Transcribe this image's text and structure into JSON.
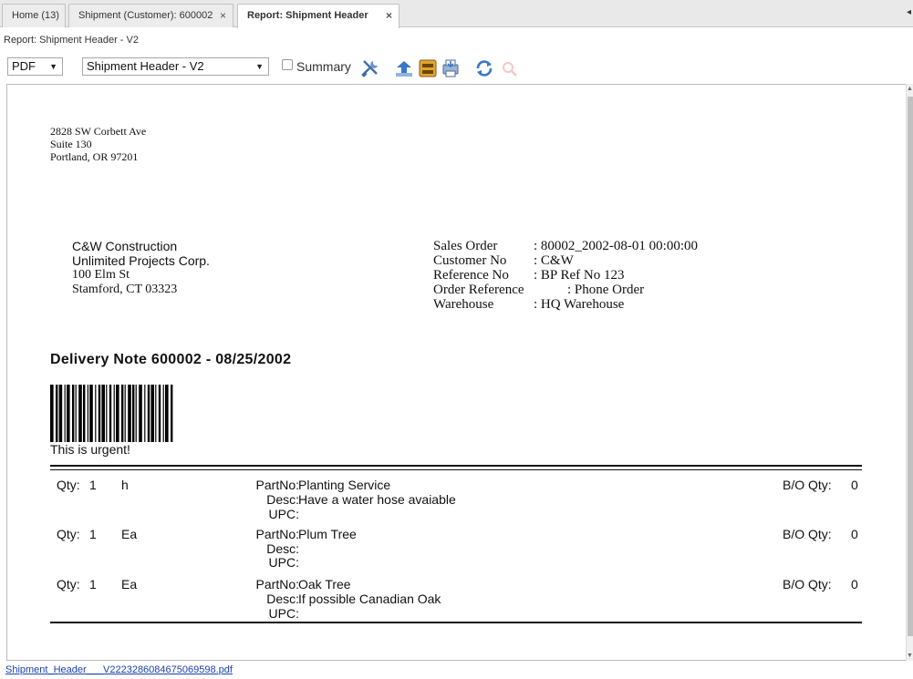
{
  "tabs": [
    {
      "label": "Home (13)"
    },
    {
      "label": "Shipment (Customer): 600002",
      "close": "×"
    },
    {
      "label": "Report: Shipment Header",
      "close": "×"
    }
  ],
  "subtitle": "Report: Shipment Header - V2",
  "toolbar": {
    "format_value": "PDF",
    "report_value": "Shipment Header - V2",
    "summary_label": "Summary",
    "summary_checked": false,
    "icons": [
      "customize-icon",
      "export-icon",
      "archive-icon",
      "print-icon",
      "refresh-icon",
      "zoom-icon"
    ]
  },
  "report": {
    "company_address": [
      "2828 SW Corbett Ave",
      "Suite 130",
      "Portland, OR 97201"
    ],
    "ship_to": [
      "C&W Construction",
      "Unlimited Projects Corp.",
      "100 Elm St",
      "Stamford, CT 03323"
    ],
    "info": [
      {
        "key": "Sales Order",
        "value": ": 80002_2002-08-01 00:00:00"
      },
      {
        "key": "Customer No",
        "value": ": C&W"
      },
      {
        "key": "Reference No",
        "value": ": BP Ref No 123"
      },
      {
        "key": "Order Reference",
        "value": ": Phone Order"
      },
      {
        "key": "Warehouse",
        "value": ": HQ Warehouse"
      }
    ],
    "heading": "Delivery Note  600002   -  08/25/2002",
    "note": "This is urgent!",
    "labels": {
      "qty": "Qty:",
      "partno": "PartNo:",
      "desc": "Desc:",
      "upc": "UPC:",
      "bo_qty": "B/O Qty:"
    },
    "lines": [
      {
        "qty": "1",
        "uom": "h",
        "partno": "Planting Service",
        "desc": "Have a water hose avaiable",
        "upc": "",
        "bo_qty": "0"
      },
      {
        "qty": "1",
        "uom": "Ea",
        "partno": "Plum Tree",
        "desc": "",
        "upc": "",
        "bo_qty": "0"
      },
      {
        "qty": "1",
        "uom": "Ea",
        "partno": "Oak Tree",
        "desc": "If possible Canadian Oak",
        "upc": "",
        "bo_qty": "0"
      }
    ]
  },
  "footer_link": "Shipment_Header___V2223286084675069598.pdf",
  "colors": {
    "link": "#1a3fb0",
    "tab_bg": "#ececec",
    "accent_blue": "#3a78c9"
  }
}
